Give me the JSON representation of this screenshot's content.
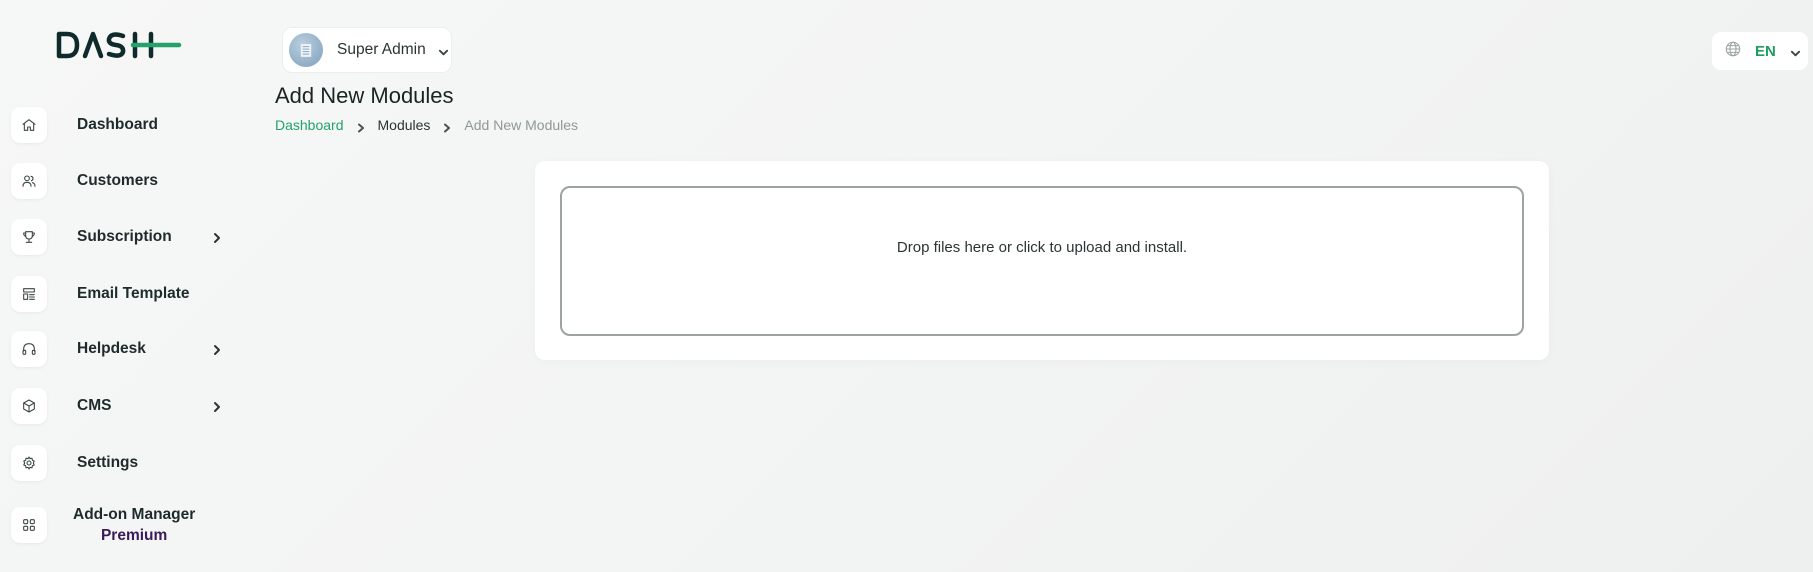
{
  "brand": {
    "logo_text": "DASH",
    "accent": "#23a26a",
    "dark": "#0f2a2a"
  },
  "sidebar": {
    "items": [
      {
        "label": "Dashboard",
        "icon": "home-icon",
        "has_submenu": false
      },
      {
        "label": "Customers",
        "icon": "users-icon",
        "has_submenu": false
      },
      {
        "label": "Subscription",
        "icon": "trophy-icon",
        "has_submenu": true
      },
      {
        "label": "Email Template",
        "icon": "template-icon",
        "has_submenu": false
      },
      {
        "label": "Helpdesk",
        "icon": "headphones-icon",
        "has_submenu": true
      },
      {
        "label": "CMS",
        "icon": "box-icon",
        "has_submenu": true
      },
      {
        "label": "Settings",
        "icon": "gear-icon",
        "has_submenu": false
      }
    ],
    "addon": {
      "label": "Add-on Manager",
      "badge": "Premium",
      "icon": "grid-icon",
      "badge_color": "#3b1a5a"
    }
  },
  "header": {
    "user": {
      "name": "Super Admin",
      "avatar_icon": "building-icon"
    },
    "language": {
      "code": "EN",
      "icon": "globe-icon"
    }
  },
  "page": {
    "title": "Add New Modules",
    "breadcrumb": [
      "Dashboard",
      "Modules",
      "Add New Modules"
    ]
  },
  "upload": {
    "text": "Drop files here or click to upload and install."
  }
}
